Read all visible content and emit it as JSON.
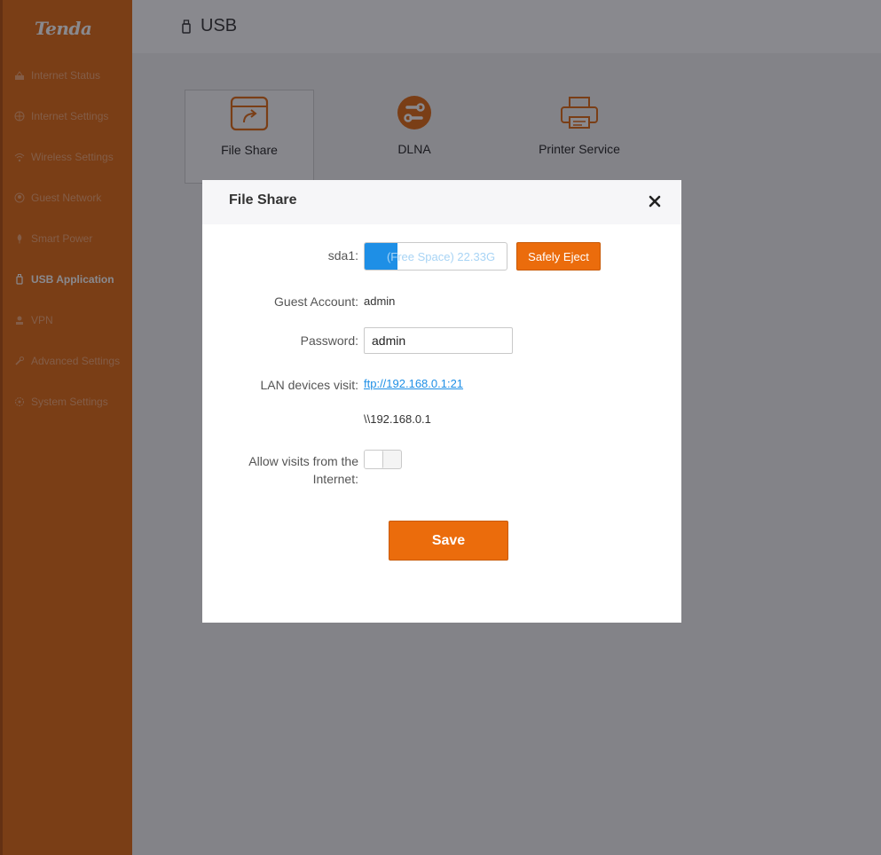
{
  "sidebar": {
    "logo": "Tenda",
    "items": [
      {
        "label": "Internet Status",
        "icon": "globe-status-icon"
      },
      {
        "label": "Internet Settings",
        "icon": "globe-icon"
      },
      {
        "label": "Wireless Settings",
        "icon": "wifi-icon"
      },
      {
        "label": "Guest Network",
        "icon": "guest-icon"
      },
      {
        "label": "Smart Power",
        "icon": "power-icon"
      },
      {
        "label": "USB Application",
        "icon": "usb-icon",
        "active": true
      },
      {
        "label": "VPN",
        "icon": "vpn-icon"
      },
      {
        "label": "Advanced Settings",
        "icon": "wrench-icon"
      },
      {
        "label": "System Settings",
        "icon": "gear-icon"
      }
    ]
  },
  "header": {
    "title": "USB"
  },
  "tiles": [
    {
      "label": "File Share",
      "icon": "file-share-icon",
      "selected": true
    },
    {
      "label": "DLNA",
      "icon": "dlna-icon"
    },
    {
      "label": "Printer Service",
      "icon": "printer-icon"
    }
  ],
  "modal": {
    "title": "File Share",
    "sda_label": "sda1:",
    "storage_text": "(Free Space) 22.33G",
    "storage_used_fraction": 0.23,
    "eject_label": "Safely Eject",
    "guest_label": "Guest Account:",
    "guest_value": "admin",
    "password_label": "Password:",
    "password_value": "admin",
    "lan_label": "LAN devices visit:",
    "ftp_link": "ftp://192.168.0.1:21",
    "smb_path": "\\\\192.168.0.1",
    "internet_label_line1": "Allow visits from the",
    "internet_label_line2": "Internet:",
    "internet_enabled": false,
    "save_label": "Save"
  },
  "colors": {
    "brand": "#e0680f",
    "accent_blue": "#1e8fe6"
  }
}
